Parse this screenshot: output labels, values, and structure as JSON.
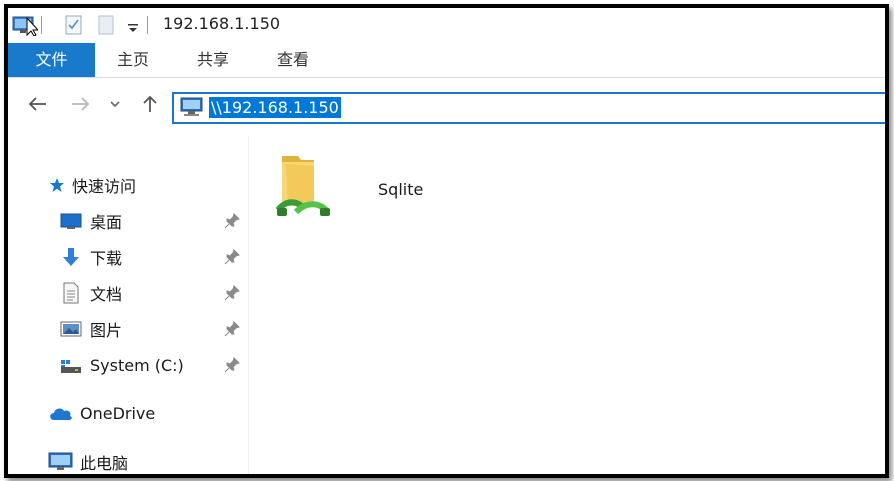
{
  "window": {
    "title": "192.168.1.150"
  },
  "ribbon": {
    "tabs": [
      {
        "label": "文件"
      },
      {
        "label": "主页"
      },
      {
        "label": "共享"
      },
      {
        "label": "查看"
      }
    ]
  },
  "address": {
    "path": "\\\\192.168.1.150"
  },
  "nav": {
    "quick_access": "快速访问",
    "items": [
      {
        "label": "桌面",
        "icon": "desktop-icon"
      },
      {
        "label": "下载",
        "icon": "download-icon"
      },
      {
        "label": "文档",
        "icon": "document-icon"
      },
      {
        "label": "图片",
        "icon": "pictures-icon"
      },
      {
        "label": "System (C:)",
        "icon": "drive-icon"
      }
    ],
    "onedrive": "OneDrive",
    "this_pc": "此电脑"
  },
  "content": {
    "items": [
      {
        "name": "Sqlite",
        "icon": "shared-folder-icon"
      }
    ]
  },
  "colors": {
    "accent": "#1979ca",
    "selection": "#0078d7"
  }
}
